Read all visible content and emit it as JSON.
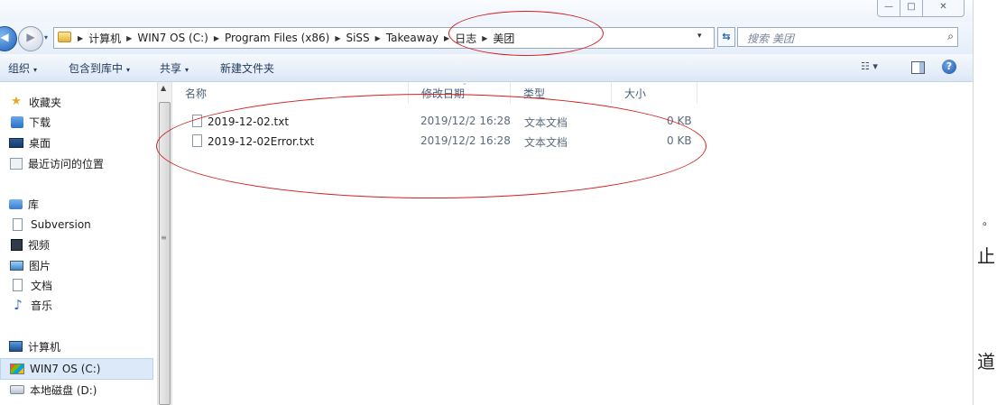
{
  "window": {
    "controls": {
      "minimize": "—",
      "maximize": "□",
      "close": "✕"
    }
  },
  "nav": {
    "back_glyph": "◀",
    "forward_glyph": "▶",
    "recent_glyph": "▾"
  },
  "address": {
    "crumbs": [
      "计算机",
      "WIN7 OS (C:)",
      "Program Files (x86)",
      "SiSS",
      "Takeaway",
      "日志",
      "美团"
    ],
    "separator": "▶",
    "dropdown_glyph": "▾",
    "refresh_glyph": "⇆"
  },
  "search": {
    "placeholder": "搜索 美团",
    "icon_glyph": "⌕"
  },
  "toolbar": {
    "organize": "组织",
    "include_in_library": "包含到库中",
    "share": "共享",
    "new_folder": "新建文件夹",
    "dropdown_glyph": "▾",
    "view_glyph": "☷ ▾",
    "help_glyph": "?"
  },
  "sidebar": {
    "favorites": "收藏夹",
    "downloads": "下载",
    "desktop": "桌面",
    "recent_places": "最近访问的位置",
    "libraries": "库",
    "subversion": "Subversion",
    "videos": "视频",
    "pictures": "图片",
    "documents": "文档",
    "music": "音乐",
    "computer": "计算机",
    "drive_c": "WIN7 OS (C:)",
    "drive_d": "本地磁盘 (D:)",
    "scroll_up_glyph": "▲",
    "scroll_grip_glyph": "≡"
  },
  "columns": {
    "name": "名称",
    "modified": "修改日期",
    "type": "类型",
    "size": "大小",
    "sort_glyph": "⌄"
  },
  "files": [
    {
      "name": "2019-12-02.txt",
      "modified": "2019/12/2 16:28",
      "type": "文本文档",
      "size": "0 KB"
    },
    {
      "name": "2019-12-02Error.txt",
      "modified": "2019/12/2 16:28",
      "type": "文本文档",
      "size": "0 KB"
    }
  ],
  "background_window": {
    "char1": "。",
    "char2": "止",
    "char3": "道"
  },
  "colors": {
    "annotation": "#d41e1e",
    "selection": "#dbe9f9",
    "link": "#1e395b"
  }
}
